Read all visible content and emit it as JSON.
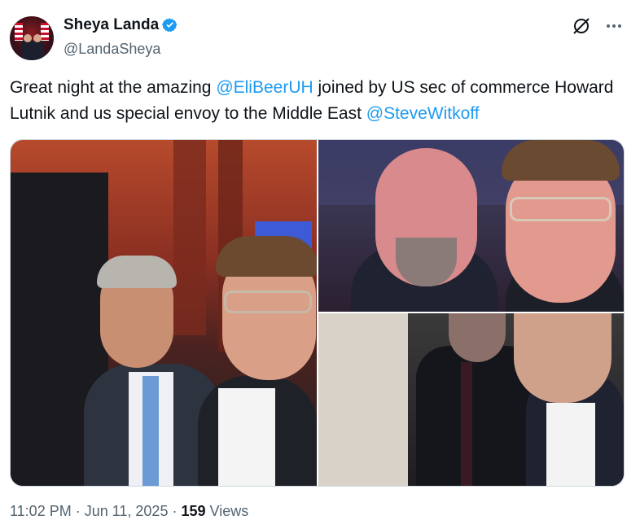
{
  "author": {
    "display_name": "Sheya Landa",
    "handle": "@LandaSheya",
    "verified": true,
    "verified_color": "#1d9bf0"
  },
  "tweet": {
    "text_parts": [
      {
        "text": "Great night at the amazing ",
        "type": "text"
      },
      {
        "text": "@EliBeerUH",
        "type": "mention"
      },
      {
        "text": " joined by US sec of commerce Howard Lutnik and us special envoy to the Middle East ",
        "type": "text"
      },
      {
        "text": "@SteveWitkoff",
        "type": "mention"
      }
    ],
    "mention_color": "#1d9bf0"
  },
  "icons": {
    "grok": "grok-icon",
    "more": "more-options-icon"
  },
  "footer": {
    "time_date": "11:02 PM · Jun 11, 2025 · ",
    "views_count": "159",
    "views_label": " Views"
  }
}
